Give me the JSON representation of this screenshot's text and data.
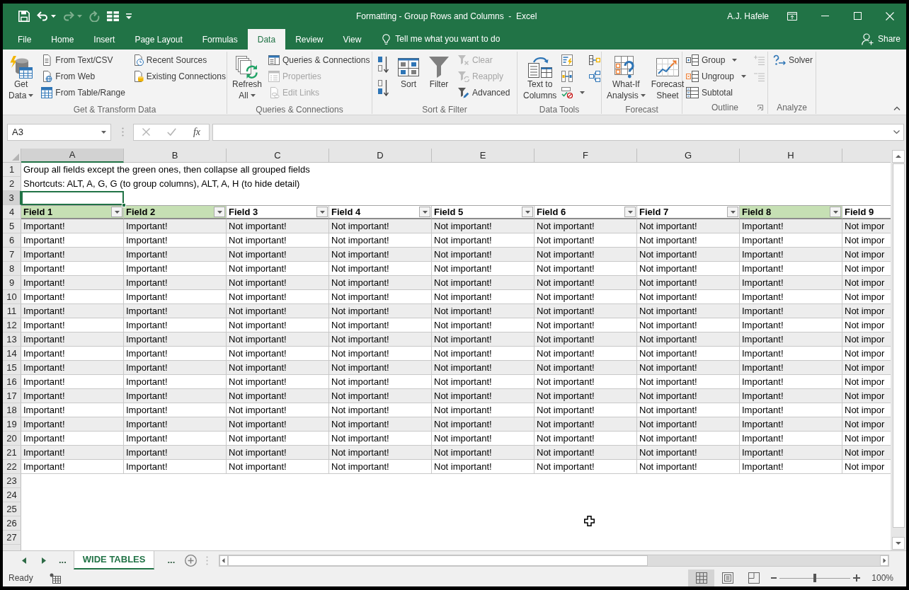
{
  "window": {
    "title": "Formatting - Group Rows and Columns  -  Excel",
    "user": "A.J. Hafele"
  },
  "quick_access": [
    {
      "kind": "save",
      "disabled": false
    },
    {
      "kind": "undo",
      "disabled": false
    },
    {
      "kind": "redo",
      "disabled": true
    },
    {
      "kind": "repeat",
      "disabled": true
    },
    {
      "kind": "form",
      "disabled": false
    },
    {
      "kind": "customize",
      "disabled": false
    }
  ],
  "ribbon_tabs": [
    {
      "label": "File",
      "selected": false
    },
    {
      "label": "Home",
      "selected": false
    },
    {
      "label": "Insert",
      "selected": false
    },
    {
      "label": "Page Layout",
      "selected": false
    },
    {
      "label": "Formulas",
      "selected": false
    },
    {
      "label": "Data",
      "selected": true
    },
    {
      "label": "Review",
      "selected": false
    },
    {
      "label": "View",
      "selected": false
    }
  ],
  "tell_me": {
    "placeholder": "Tell me what you want to do"
  },
  "share": {
    "label": "Share"
  },
  "ribbon_groups": [
    {
      "label": "Get & Transform Data",
      "columns": [
        [
          {
            "kind": "get_data",
            "lines": [
              "Get",
              "Data"
            ],
            "dropdown": true,
            "disabled": false
          }
        ],
        [
          {
            "kind": "from_text",
            "label": "From Text/CSV",
            "disabled": false
          },
          {
            "kind": "from_web",
            "label": "From Web",
            "disabled": false
          },
          {
            "kind": "from_table",
            "label": "From Table/Range",
            "disabled": false
          }
        ],
        [
          {
            "kind": "recent_sources",
            "label": "Recent Sources",
            "disabled": false
          },
          {
            "kind": "existing_connections",
            "label": "Existing Connections",
            "disabled": false
          }
        ]
      ]
    },
    {
      "label": "Queries & Connections",
      "columns": [
        [
          {
            "kind": "refresh_all",
            "lines": [
              "Refresh",
              "All"
            ],
            "dropdown": true,
            "disabled": false
          }
        ],
        [
          {
            "kind": "queries_connections",
            "label": "Queries & Connections",
            "disabled": false
          },
          {
            "kind": "properties",
            "label": "Properties",
            "disabled": true
          },
          {
            "kind": "edit_links",
            "label": "Edit Links",
            "disabled": true
          }
        ]
      ]
    },
    {
      "label": "Sort & Filter",
      "columns": [
        [
          {
            "kind": "sort_az",
            "disabled": false
          },
          {
            "kind": "sort_za",
            "disabled": false
          }
        ],
        [
          {
            "kind": "sort",
            "lines": [
              "Sort"
            ],
            "disabled": false
          }
        ],
        [
          {
            "kind": "filter",
            "lines": [
              "Filter"
            ],
            "disabled": false
          }
        ],
        [
          {
            "kind": "clear",
            "label": "Clear",
            "disabled": true
          },
          {
            "kind": "reapply",
            "label": "Reapply",
            "disabled": true
          },
          {
            "kind": "advanced",
            "label": "Advanced",
            "disabled": false
          }
        ]
      ]
    },
    {
      "label": "Data Tools",
      "columns": [
        [
          {
            "kind": "text_to_columns",
            "lines": [
              "Text to",
              "Columns"
            ],
            "disabled": false
          }
        ],
        [
          {
            "kind": "flash_fill",
            "disabled": false
          },
          {
            "kind": "remove_duplicates",
            "disabled": false
          },
          {
            "kind": "data_validation",
            "dropdown": true,
            "disabled": false
          }
        ],
        [
          {
            "kind": "consolidate",
            "disabled": false
          },
          {
            "kind": "relationships",
            "disabled": false
          }
        ]
      ]
    },
    {
      "label": "Forecast",
      "columns": [
        [
          {
            "kind": "what_if",
            "lines": [
              "What-If",
              "Analysis"
            ],
            "dropdown": true,
            "disabled": false
          }
        ],
        [
          {
            "kind": "forecast_sheet",
            "lines": [
              "Forecast",
              "Sheet"
            ],
            "disabled": false
          }
        ]
      ]
    },
    {
      "label": "Outline",
      "launcher": true,
      "columns": [
        [
          {
            "kind": "group",
            "label": "Group",
            "dropdown": true,
            "disabled": false
          },
          {
            "kind": "ungroup",
            "label": "Ungroup",
            "dropdown": true,
            "disabled": false
          },
          {
            "kind": "subtotal",
            "label": "Subtotal",
            "disabled": false
          }
        ],
        [
          {
            "kind": "show_detail",
            "disabled": true
          },
          {
            "kind": "hide_detail",
            "disabled": true
          }
        ]
      ]
    },
    {
      "label": "Analyze",
      "columns": [
        [
          {
            "kind": "solver",
            "label": "Solver",
            "disabled": false
          }
        ]
      ]
    }
  ],
  "formula_bar": {
    "name_box": "A3",
    "insert_function": "fx"
  },
  "sheet": {
    "columns": [
      {
        "letter": "A",
        "selected": true
      },
      {
        "letter": "B",
        "selected": false
      },
      {
        "letter": "C",
        "selected": false
      },
      {
        "letter": "D",
        "selected": false
      },
      {
        "letter": "E",
        "selected": false
      },
      {
        "letter": "F",
        "selected": false
      },
      {
        "letter": "G",
        "selected": false
      },
      {
        "letter": "H",
        "selected": false
      }
    ],
    "row_headers": [
      {
        "label": "1",
        "selected": false
      },
      {
        "label": "2",
        "selected": false
      },
      {
        "label": "3",
        "selected": true
      },
      {
        "label": "4",
        "selected": false
      },
      {
        "label": "5",
        "selected": false
      },
      {
        "label": "6",
        "selected": false
      },
      {
        "label": "7",
        "selected": false
      },
      {
        "label": "8",
        "selected": false
      },
      {
        "label": "9",
        "selected": false
      },
      {
        "label": "10",
        "selected": false
      },
      {
        "label": "11",
        "selected": false
      },
      {
        "label": "12",
        "selected": false
      },
      {
        "label": "13",
        "selected": false
      },
      {
        "label": "14",
        "selected": false
      },
      {
        "label": "15",
        "selected": false
      },
      {
        "label": "16",
        "selected": false
      },
      {
        "label": "17",
        "selected": false
      },
      {
        "label": "18",
        "selected": false
      },
      {
        "label": "19",
        "selected": false
      },
      {
        "label": "20",
        "selected": false
      },
      {
        "label": "21",
        "selected": false
      },
      {
        "label": "22",
        "selected": false
      },
      {
        "label": "23",
        "selected": false
      },
      {
        "label": "24",
        "selected": false
      },
      {
        "label": "25",
        "selected": false
      },
      {
        "label": "26",
        "selected": false
      },
      {
        "label": "27",
        "selected": false
      }
    ],
    "notes": [
      "Group all fields except the green ones, then collapse all grouped fields",
      "Shortcuts: ALT, A, G, G (to group columns), ALT, A, H (to hide detail)"
    ],
    "table": {
      "filter_buttons": true,
      "header": [
        {
          "label": "Field 1",
          "color": "#c6e0b4"
        },
        {
          "label": "Field 2",
          "color": "#c6e0b4"
        },
        {
          "label": "Field 3",
          "color": "#ffffff"
        },
        {
          "label": "Field 4",
          "color": "#ffffff"
        },
        {
          "label": "Field 5",
          "color": "#ffffff"
        },
        {
          "label": "Field 6",
          "color": "#ffffff"
        },
        {
          "label": "Field 7",
          "color": "#ffffff"
        },
        {
          "label": "Field 8",
          "color": "#c6e0b4"
        },
        {
          "label": "Field 9",
          "color": "#ffffff"
        }
      ],
      "rows": [
        [
          "Important!",
          "Important!",
          "Not important!",
          "Not important!",
          "Not important!",
          "Not important!",
          "Not important!",
          "Important!",
          "Not impor"
        ],
        [
          "Important!",
          "Important!",
          "Not important!",
          "Not important!",
          "Not important!",
          "Not important!",
          "Not important!",
          "Important!",
          "Not impor"
        ],
        [
          "Important!",
          "Important!",
          "Not important!",
          "Not important!",
          "Not important!",
          "Not important!",
          "Not important!",
          "Important!",
          "Not impor"
        ],
        [
          "Important!",
          "Important!",
          "Not important!",
          "Not important!",
          "Not important!",
          "Not important!",
          "Not important!",
          "Important!",
          "Not impor"
        ],
        [
          "Important!",
          "Important!",
          "Not important!",
          "Not important!",
          "Not important!",
          "Not important!",
          "Not important!",
          "Important!",
          "Not impor"
        ],
        [
          "Important!",
          "Important!",
          "Not important!",
          "Not important!",
          "Not important!",
          "Not important!",
          "Not important!",
          "Important!",
          "Not impor"
        ],
        [
          "Important!",
          "Important!",
          "Not important!",
          "Not important!",
          "Not important!",
          "Not important!",
          "Not important!",
          "Important!",
          "Not impor"
        ],
        [
          "Important!",
          "Important!",
          "Not important!",
          "Not important!",
          "Not important!",
          "Not important!",
          "Not important!",
          "Important!",
          "Not impor"
        ],
        [
          "Important!",
          "Important!",
          "Not important!",
          "Not important!",
          "Not important!",
          "Not important!",
          "Not important!",
          "Important!",
          "Not impor"
        ],
        [
          "Important!",
          "Important!",
          "Not important!",
          "Not important!",
          "Not important!",
          "Not important!",
          "Not important!",
          "Important!",
          "Not impor"
        ],
        [
          "Important!",
          "Important!",
          "Not important!",
          "Not important!",
          "Not important!",
          "Not important!",
          "Not important!",
          "Important!",
          "Not impor"
        ],
        [
          "Important!",
          "Important!",
          "Not important!",
          "Not important!",
          "Not important!",
          "Not important!",
          "Not important!",
          "Important!",
          "Not impor"
        ],
        [
          "Important!",
          "Important!",
          "Not important!",
          "Not important!",
          "Not important!",
          "Not important!",
          "Not important!",
          "Important!",
          "Not impor"
        ],
        [
          "Important!",
          "Important!",
          "Not important!",
          "Not important!",
          "Not important!",
          "Not important!",
          "Not important!",
          "Important!",
          "Not impor"
        ],
        [
          "Important!",
          "Important!",
          "Not important!",
          "Not important!",
          "Not important!",
          "Not important!",
          "Not important!",
          "Important!",
          "Not impor"
        ],
        [
          "Important!",
          "Important!",
          "Not important!",
          "Not important!",
          "Not important!",
          "Not important!",
          "Not important!",
          "Important!",
          "Not impor"
        ],
        [
          "Important!",
          "Important!",
          "Not important!",
          "Not important!",
          "Not important!",
          "Not important!",
          "Not important!",
          "Important!",
          "Not impor"
        ],
        [
          "Important!",
          "Important!",
          "Not important!",
          "Not important!",
          "Not important!",
          "Not important!",
          "Not important!",
          "Important!",
          "Not impor"
        ]
      ]
    }
  },
  "sheet_tabs": {
    "scroll_left": "...",
    "tabs": [
      {
        "label": "WIDE TABLES",
        "selected": true
      }
    ],
    "scroll_right": "..."
  },
  "status_bar": {
    "text": "Ready",
    "views": [
      {
        "kind": "normal",
        "selected": true
      },
      {
        "kind": "page_layout",
        "selected": false
      },
      {
        "kind": "page_break",
        "selected": false
      }
    ],
    "zoom": {
      "level": 0.5,
      "label": "100%"
    }
  }
}
